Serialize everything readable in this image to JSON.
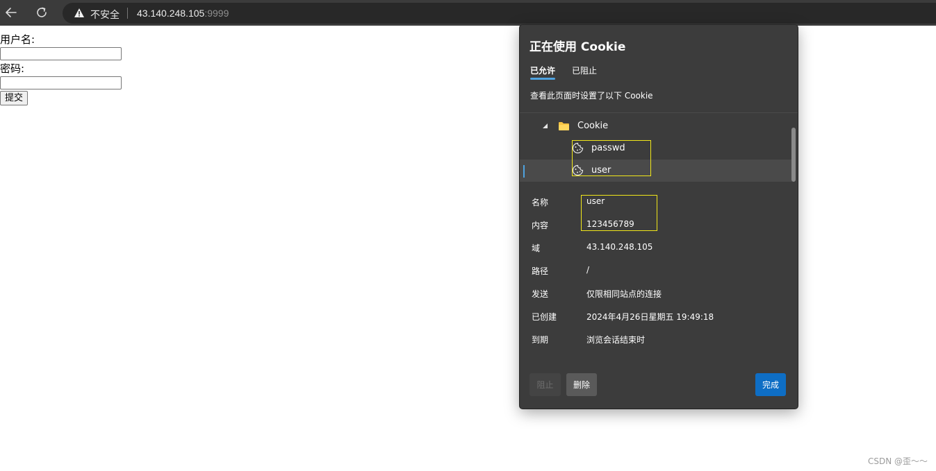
{
  "browser": {
    "security_label": "不安全",
    "url_host": "43.140.248.105",
    "url_port": ":9999"
  },
  "form": {
    "username_label": "用户名:",
    "password_label": "密码:",
    "submit_label": "提交"
  },
  "cookie_popup": {
    "title": "正在使用 Cookie",
    "tabs": [
      {
        "label": "已允许",
        "active": true
      },
      {
        "label": "已阻止",
        "active": false
      }
    ],
    "description": "查看此页面时设置了以下 Cookie",
    "tree": {
      "folder": "Cookie",
      "cookies": [
        "passwd",
        "user"
      ],
      "selected": "user"
    },
    "details": [
      {
        "label": "名称",
        "value": "user"
      },
      {
        "label": "内容",
        "value": "123456789"
      },
      {
        "label": "域",
        "value": "43.140.248.105"
      },
      {
        "label": "路径",
        "value": "/"
      },
      {
        "label": "发送",
        "value": "仅限相同站点的连接"
      },
      {
        "label": "已创建",
        "value": "2024年4月26日星期五 19:49:18"
      },
      {
        "label": "到期",
        "value": "浏览会话结束时"
      }
    ],
    "buttons": {
      "block": "阻止",
      "delete": "删除",
      "done": "完成"
    }
  },
  "watermark": "CSDN @歪～～",
  "colors": {
    "accent": "#0e6ec5",
    "highlight_box": "#f2e81a",
    "popup_bg": "#3c3c3c"
  }
}
